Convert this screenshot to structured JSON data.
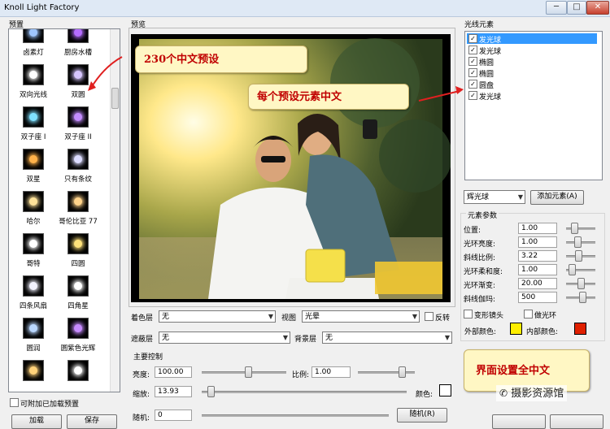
{
  "window": {
    "title": "Knoll Light Factory",
    "minimize": "─",
    "maximize": "□",
    "close": "✕"
  },
  "presets": {
    "header": "预置",
    "items": [
      {
        "label": "卤素灯",
        "glow": "#9fc6ff"
      },
      {
        "label": "厨房水槽",
        "glow": "#b56cff"
      },
      {
        "label": "双向光线",
        "glow": "#ffffff"
      },
      {
        "label": "双圆",
        "glow": "#d7c6ff"
      },
      {
        "label": "双子座 I",
        "glow": "#7fe1ff"
      },
      {
        "label": "双子座 II",
        "glow": "#c48cff"
      },
      {
        "label": "双星",
        "glow": "#ffb24a"
      },
      {
        "label": "只有条纹",
        "glow": "#dcdcff"
      },
      {
        "label": "哈尔",
        "glow": "#ffe39a"
      },
      {
        "label": "哥伦比亚 77",
        "glow": "#ffd38a"
      },
      {
        "label": "哥特",
        "glow": "#ffffff"
      },
      {
        "label": "四圆",
        "glow": "#ffe27a"
      },
      {
        "label": "四条风扇",
        "glow": "#f2f2ff"
      },
      {
        "label": "四角星",
        "glow": "#ffffff"
      },
      {
        "label": "圆润",
        "glow": "#b9d7ff"
      },
      {
        "label": "圆紫色光辉",
        "glow": "#c78bff"
      },
      {
        "label": "",
        "glow": "#ffd27a"
      },
      {
        "label": "",
        "glow": "#ffffff"
      }
    ],
    "checkbox_label": "可附加已加载预置",
    "btn_left": "加载",
    "btn_right": "保存"
  },
  "preview": {
    "header": "预览"
  },
  "elements": {
    "header": "光线元素",
    "items": [
      {
        "label": "发光球",
        "checked": "✓"
      },
      {
        "label": "发光球",
        "checked": "✓"
      },
      {
        "label": "椭圆",
        "checked": "✓"
      },
      {
        "label": "椭圆",
        "checked": "✓"
      },
      {
        "label": "圆盘",
        "checked": "✓"
      },
      {
        "label": "发光球",
        "checked": "✓"
      }
    ],
    "type_select": "辉光球",
    "add_button": "添加元素(A)"
  },
  "params": {
    "header": "元素参数",
    "rows": [
      {
        "label": "位置:",
        "value": "1.00",
        "level": 0.2
      },
      {
        "label": "光环亮度:",
        "value": "1.00",
        "level": 0.3
      },
      {
        "label": "斜线比例:",
        "value": "3.22",
        "level": 0.35
      },
      {
        "label": "光环柔和度:",
        "value": "1.00",
        "level": 0.1
      },
      {
        "label": "光环渐变:",
        "value": "20.00",
        "level": 0.45
      },
      {
        "label": "斜线伽玛:",
        "value": "500",
        "level": 0.5
      }
    ],
    "distort": "变形镜头",
    "do_ring": "做光环",
    "outer_color_label": "外部颜色:",
    "outer_color": "#ffee00",
    "inner_color_label": "内部颜色:",
    "inner_color": "#e02000"
  },
  "controls": {
    "color_layer_label": "着色层",
    "color_layer_value": "无",
    "view_label": "视图",
    "view_value": "光晕",
    "invert_label": "反转",
    "mask_label": "遮蔽层",
    "mask_value": "无",
    "bg_label": "背景层",
    "bg_value": "无",
    "main_label": "主要控制",
    "brightness_label": "亮度:",
    "brightness_value": "100.00",
    "scale_ratio_label": "比例:",
    "scale_ratio_value": "1.00",
    "scale_label": "缩放:",
    "scale_value": "13.93",
    "color_label": "颜色:",
    "random_label": "随机:",
    "random_value": "0",
    "random_button": "随机(R)",
    "brightness_level": 0.55,
    "scale_ratio_level": 0.8,
    "scale_level": 0.03
  },
  "annotations": {
    "a1": "230个中文预设",
    "a2": "每个预设元素中文",
    "a3": "界面设置全中文"
  },
  "watermark": "摄影资源馆",
  "colors": {
    "callout_text": "#c00000",
    "selected": "#3399ff"
  }
}
